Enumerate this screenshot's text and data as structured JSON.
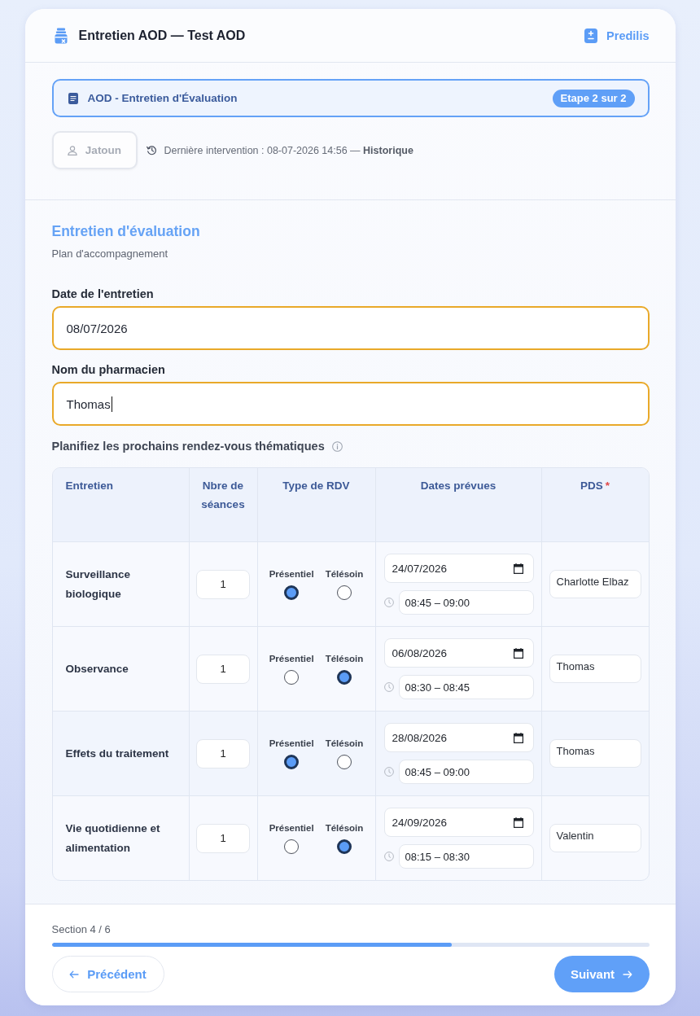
{
  "header": {
    "title": "Entretien AOD — Test AOD",
    "brand": "Predilis"
  },
  "banner": {
    "title": "AOD - Entretien d'Évaluation",
    "step": "Etape 2 sur 2"
  },
  "patient_button": {
    "label": "Jatoun",
    "disabled": true
  },
  "last_intervention": "Dernière intervention : 08-07-2026 14:56 — **Historique**",
  "section": {
    "title": "Entretien d'évaluation",
    "subtitle": "Plan d'accompagnement"
  },
  "fields": [
    {
      "label": "Date de l'entretien",
      "value": "08/07/2026",
      "focused": false
    },
    {
      "label": "Nom du pharmacien",
      "value": "Thomas",
      "focused": true
    }
  ],
  "schedule": {
    "title": "Planifiez les prochains rendez-vous thématiques",
    "columns": [
      {
        "label": "Entretien"
      },
      {
        "label": "Nbre de séances"
      },
      {
        "label": "Type de RDV"
      },
      {
        "label": "Dates prévues"
      },
      {
        "label": "PDS",
        "required_mark": "*"
      }
    ],
    "rows": [
      {
        "topic": "Surveillance biologique",
        "sessions": "1",
        "types": [
          {
            "label": "Présentiel",
            "selected": true
          },
          {
            "label": "Télésoin",
            "selected": false
          }
        ],
        "date": "24/07/2026",
        "time": "08:45 – 09:00",
        "pds": "Charlotte Elbaz"
      },
      {
        "topic": "Observance",
        "sessions": "1",
        "types": [
          {
            "label": "Présentiel",
            "selected": false
          },
          {
            "label": "Télésoin",
            "selected": true
          }
        ],
        "date": "06/08/2026",
        "time": "08:30 – 08:45",
        "pds": "Thomas"
      },
      {
        "topic": "Effets du traitement",
        "sessions": "1",
        "types": [
          {
            "label": "Présentiel",
            "selected": true
          },
          {
            "label": "Télésoin",
            "selected": false
          }
        ],
        "date": "28/08/2026",
        "time": "08:45 – 09:00",
        "pds": "Thomas"
      },
      {
        "topic": "Vie quotidienne et alimentation",
        "sessions": "1",
        "types": [
          {
            "label": "Présentiel",
            "selected": false
          },
          {
            "label": "Télésoin",
            "selected": true
          }
        ],
        "date": "24/09/2026",
        "time": "08:15 – 08:30",
        "pds": "Valentin"
      }
    ]
  },
  "progress": {
    "label": "Section 4 / 6",
    "level": 0.67
  },
  "buttons": [
    {
      "label": "Précédent",
      "kind": "secondary"
    },
    {
      "label": "Suivant",
      "kind": "primary"
    }
  ]
}
